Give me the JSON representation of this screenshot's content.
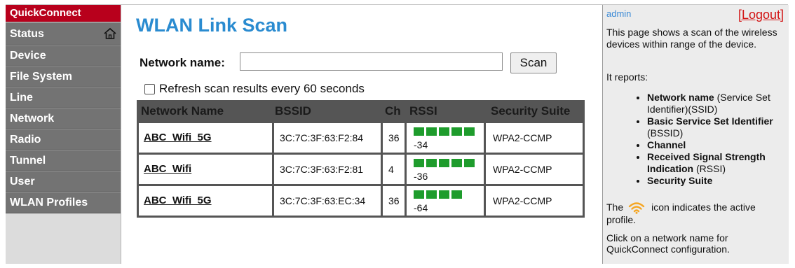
{
  "nav": {
    "brand": "QuickConnect",
    "items": [
      "Status",
      "Device",
      "File System",
      "Line",
      "Network",
      "Radio",
      "Tunnel",
      "User",
      "WLAN Profiles"
    ]
  },
  "main": {
    "title": "WLAN Link Scan",
    "network_name_label": "Network name:",
    "network_name_value": "",
    "scan_button": "Scan",
    "refresh_label": "Refresh scan results every 60 seconds",
    "refresh_checked": false,
    "table": {
      "headers": [
        "Network Name",
        "BSSID",
        "Ch",
        "RSSI",
        "Security Suite"
      ],
      "rows": [
        {
          "ssid": "ABC_Wifi_5G",
          "bssid": "3C:7C:3F:63:F2:84",
          "ch": "36",
          "rssi": "-34",
          "bars": 5,
          "security": "WPA2-CCMP"
        },
        {
          "ssid": "ABC_Wifi",
          "bssid": "3C:7C:3F:63:F2:81",
          "ch": "4",
          "rssi": "-36",
          "bars": 5,
          "security": "WPA2-CCMP"
        },
        {
          "ssid": "ABC_Wifi_5G",
          "bssid": "3C:7C:3F:63:EC:34",
          "ch": "36",
          "rssi": "-64",
          "bars": 4,
          "security": "WPA2-CCMP"
        }
      ]
    }
  },
  "help": {
    "user": "admin",
    "logout": "[Logout]",
    "intro": "This page shows a scan of the wireless devices within range of the device.",
    "reports_label": "It reports:",
    "items": [
      {
        "term": "Network name",
        "desc": " (Service Set Identifier)(SSID)"
      },
      {
        "term": "Basic Service Set Identifier",
        "desc": " (BSSID)"
      },
      {
        "term": "Channel",
        "desc": ""
      },
      {
        "term": "Received Signal Strength Indication",
        "desc": " (RSSI)"
      },
      {
        "term": "Security Suite",
        "desc": ""
      }
    ],
    "icon_note_before": "The",
    "icon_note_after": "icon indicates the active profile.",
    "click_note": "Click on a network name for QuickConnect configuration."
  },
  "colors": {
    "brand_red": "#b8001c",
    "nav_gray": "#737373",
    "title_blue": "#2a8bd0",
    "signal_green": "#1e9c2c",
    "logout_red": "#d21414",
    "wifi_orange": "#f5a623"
  },
  "icons": {
    "status": "home-icon",
    "active_profile": "wifi-icon"
  }
}
